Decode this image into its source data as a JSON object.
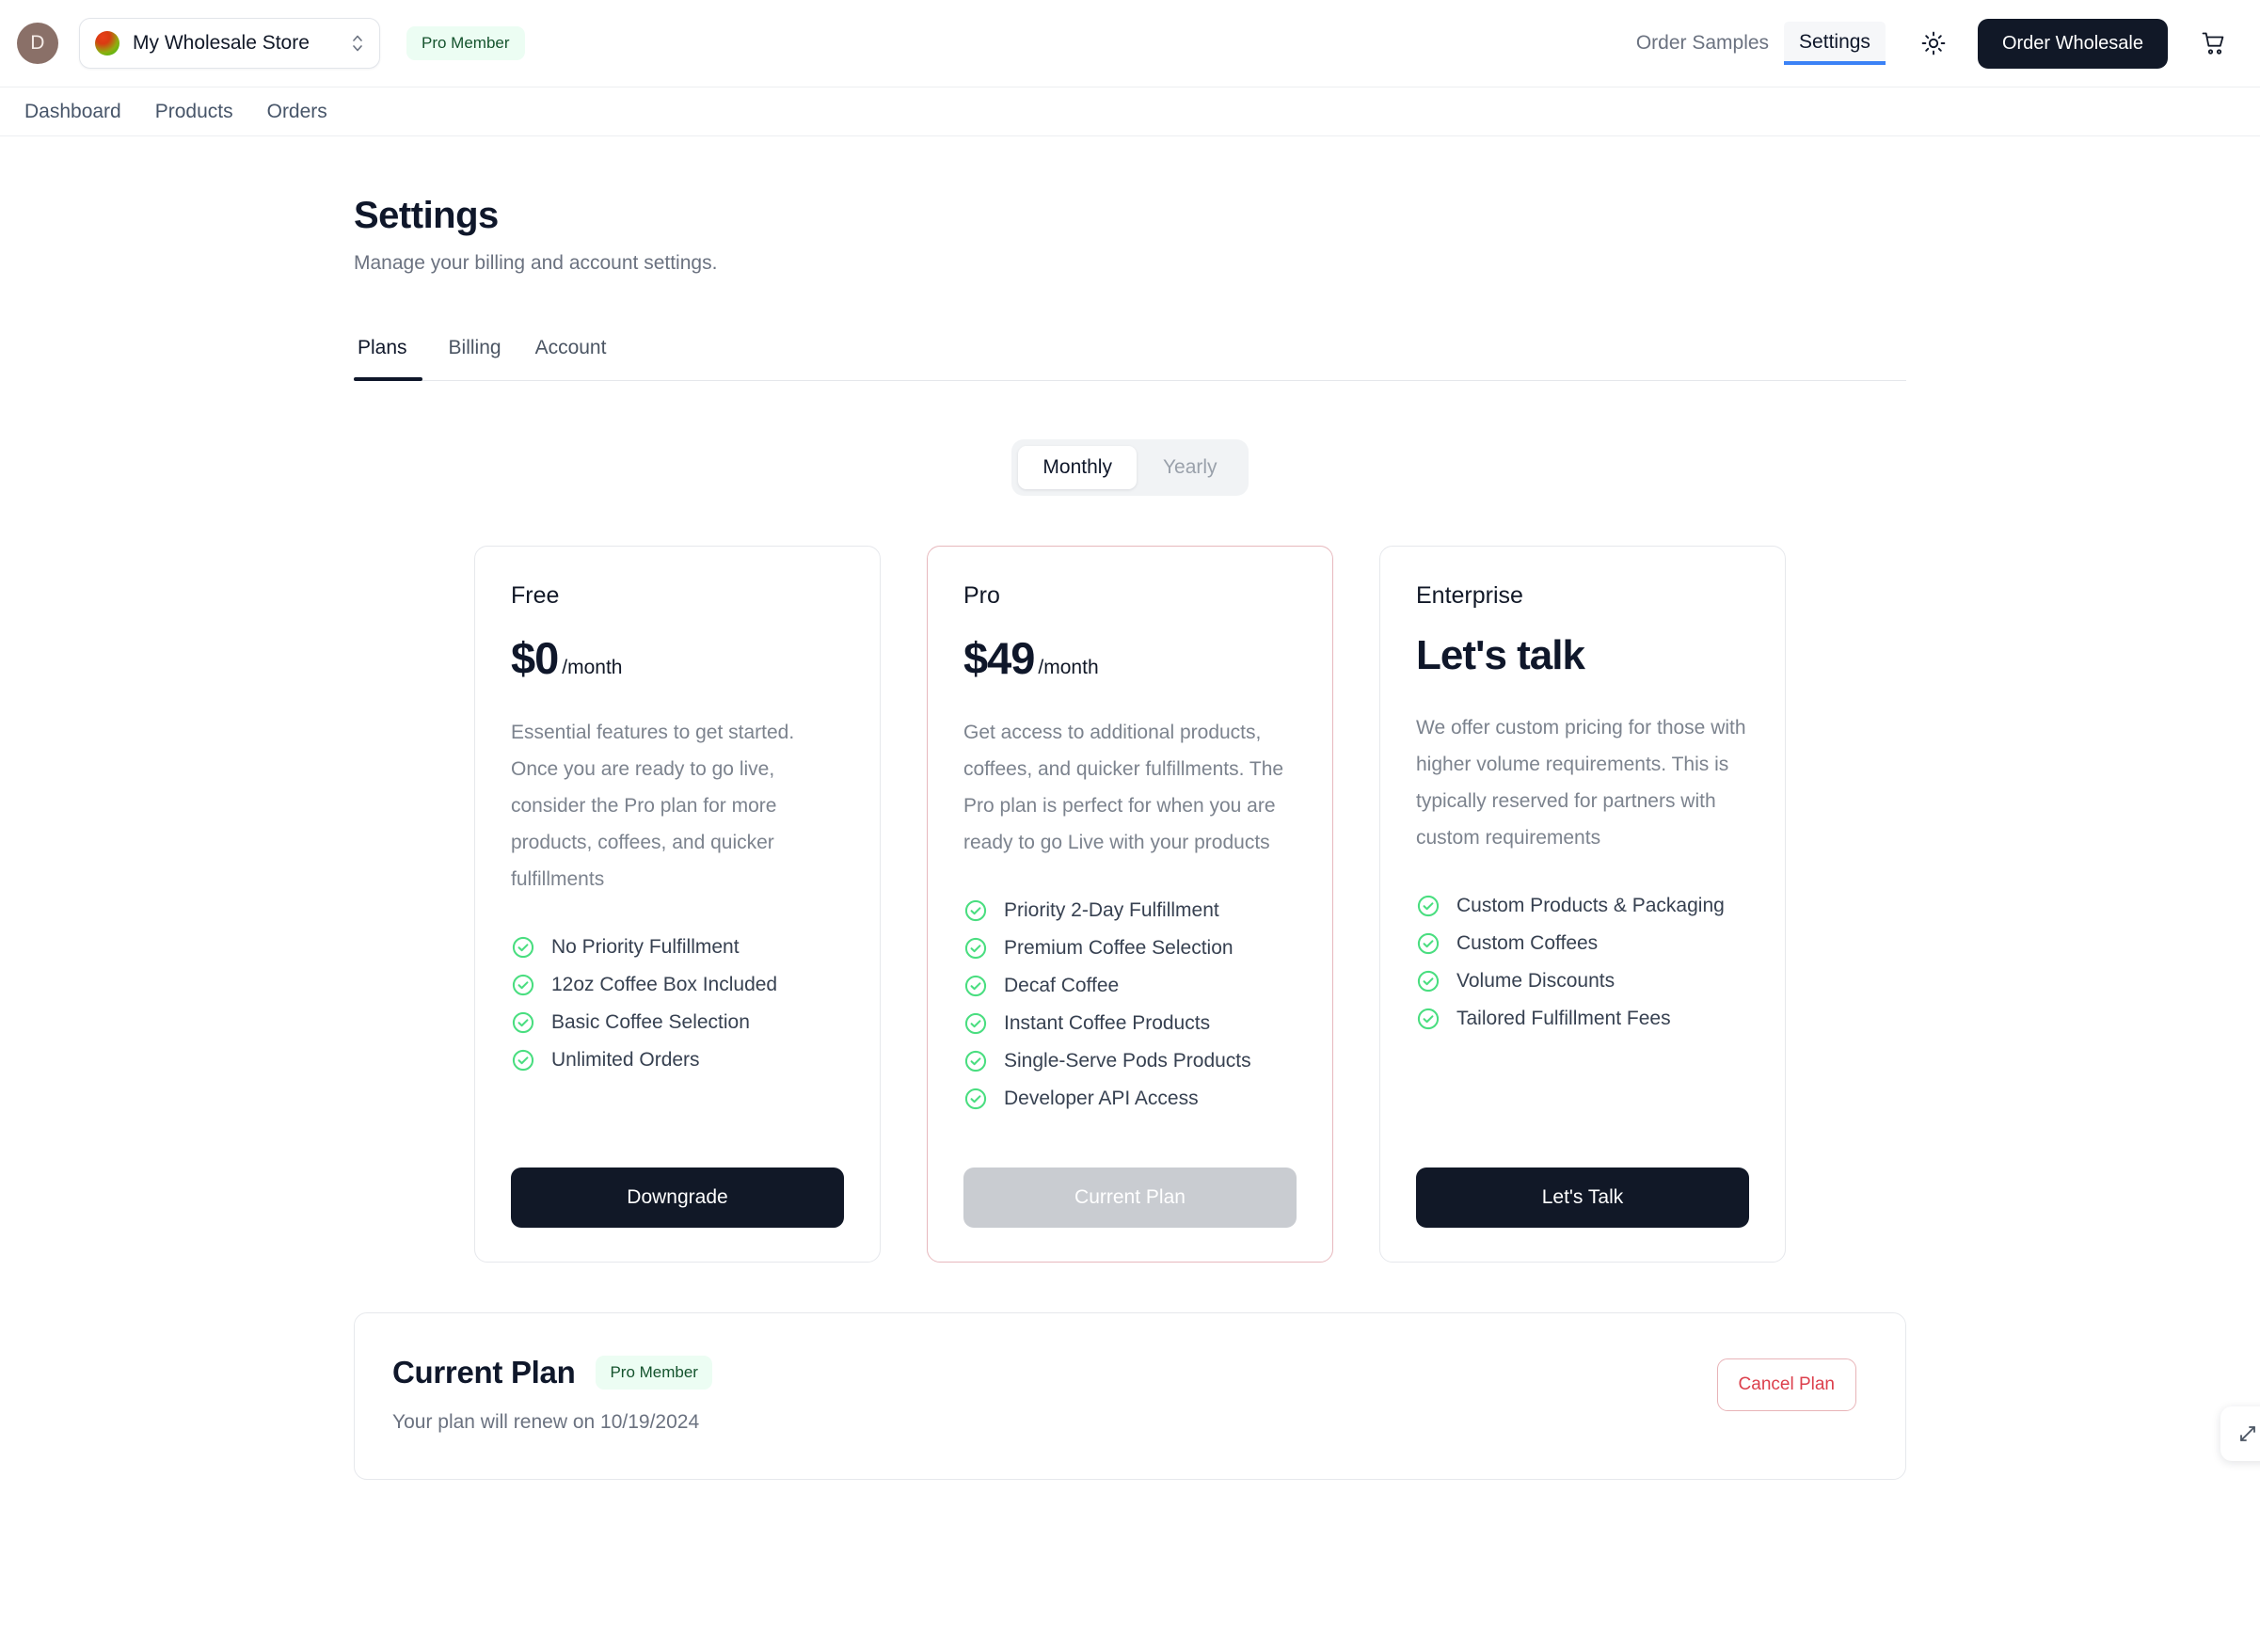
{
  "header": {
    "avatar_initial": "D",
    "store": {
      "name": "My Wholesale Store",
      "icon": "store-gradient-dot",
      "chevron_icon": "up-down-chevron-icon"
    },
    "membership_badge": "Pro Member",
    "nav": [
      {
        "label": "Order Samples",
        "active": false
      },
      {
        "label": "Settings",
        "active": true
      }
    ],
    "theme_toggle_icon": "sun-icon",
    "order_wholesale_button": "Order Wholesale",
    "cart_icon": "shopping-cart-icon",
    "accent_active": "#3b82f6"
  },
  "subnav": {
    "items": [
      {
        "label": "Dashboard"
      },
      {
        "label": "Products"
      },
      {
        "label": "Orders"
      }
    ]
  },
  "page": {
    "title": "Settings",
    "subtitle": "Manage your billing and account settings."
  },
  "tabs": [
    {
      "label": "Plans",
      "active": true
    },
    {
      "label": "Billing",
      "active": false
    },
    {
      "label": "Account",
      "active": false
    }
  ],
  "billing_cycle": {
    "options": [
      {
        "label": "Monthly",
        "selected": true
      },
      {
        "label": "Yearly",
        "selected": false
      }
    ]
  },
  "plans": [
    {
      "name": "Free",
      "price": "$0",
      "period": "/month",
      "description": "Essential features to get started. Once you are ready to go live, consider the Pro plan for more products, coffees, and quicker fulfillments",
      "features": [
        "No Priority Fulfillment",
        "12oz Coffee Box Included",
        "Basic Coffee Selection",
        "Unlimited Orders"
      ],
      "cta_label": "Downgrade",
      "cta_state": "enabled",
      "highlighted": false
    },
    {
      "name": "Pro",
      "price": "$49",
      "period": "/month",
      "description": "Get access to additional products, coffees, and quicker fulfillments. The Pro plan is perfect for when you are ready to go Live with your products",
      "features": [
        "Priority 2-Day Fulfillment",
        "Premium Coffee Selection",
        "Decaf Coffee",
        "Instant Coffee Products",
        "Single-Serve Pods Products",
        "Developer API Access"
      ],
      "cta_label": "Current Plan",
      "cta_state": "disabled",
      "highlighted": true
    },
    {
      "name": "Enterprise",
      "price": "Let's talk",
      "period": "",
      "description": "We offer custom pricing for those with higher volume requirements. This is typically reserved for partners with custom requirements",
      "features": [
        "Custom Products & Packaging",
        "Custom Coffees",
        "Volume Discounts",
        "Tailored Fulfillment Fees"
      ],
      "cta_label": "Let's Talk",
      "cta_state": "enabled",
      "highlighted": false
    }
  ],
  "current_plan": {
    "title": "Current Plan",
    "badge": "Pro Member",
    "renewal_text": "Your plan will renew on 10/19/2024",
    "cancel_label": "Cancel Plan"
  },
  "floating_widget": {
    "icon": "resize-handle-icon"
  },
  "colors": {
    "dark": "#111827",
    "check_green": "#4ade80",
    "badge_green_bg": "#ecfdf3",
    "badge_green_text": "#14532d",
    "danger": "#dc3f4c",
    "highlight_border": "#e7b8bd",
    "nav_accent": "#3b82f6"
  }
}
